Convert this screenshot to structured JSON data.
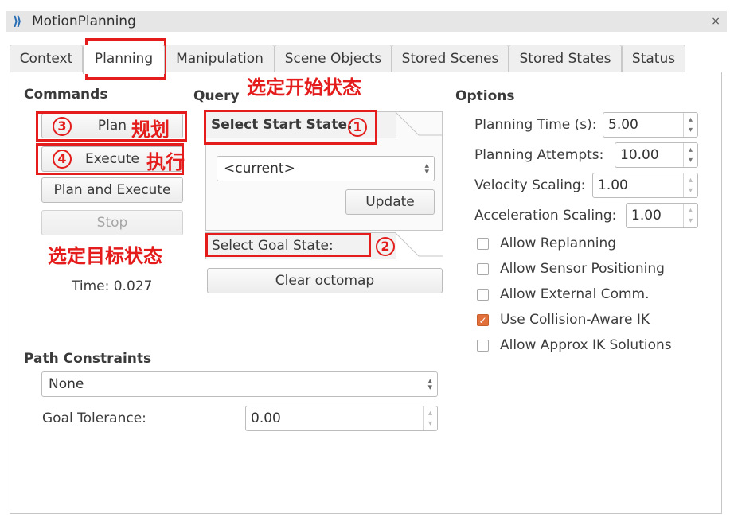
{
  "window": {
    "title": "MotionPlanning",
    "close": "×"
  },
  "tabs": [
    "Context",
    "Planning",
    "Manipulation",
    "Scene Objects",
    "Stored Scenes",
    "Stored States",
    "Status"
  ],
  "commands": {
    "label": "Commands",
    "plan": "Plan",
    "execute": "Execute",
    "plan_and_execute": "Plan and Execute",
    "stop": "Stop",
    "time": "Time: 0.027"
  },
  "query": {
    "label": "Query",
    "start_state_label": "Select Start State:",
    "start_state_value": "<current>",
    "update": "Update",
    "goal_state_label": "Select Goal State:",
    "clear_octomap": "Clear octomap"
  },
  "options": {
    "label": "Options",
    "planning_time_label": "Planning Time (s):",
    "planning_time": "5.00",
    "planning_attempts_label": "Planning Attempts:",
    "planning_attempts": "10.00",
    "velocity_scaling_label": "Velocity Scaling:",
    "velocity_scaling": "1.00",
    "acceleration_scaling_label": "Acceleration Scaling:",
    "acceleration_scaling": "1.00",
    "checkboxes": [
      {
        "label": "Allow Replanning",
        "checked": false
      },
      {
        "label": "Allow Sensor Positioning",
        "checked": false
      },
      {
        "label": "Allow External Comm.",
        "checked": false
      },
      {
        "label": "Use Collision-Aware IK",
        "checked": true
      },
      {
        "label": "Allow Approx IK Solutions",
        "checked": false
      }
    ]
  },
  "path_constraints": {
    "label": "Path Constraints",
    "value": "None",
    "goal_tolerance_label": "Goal Tolerance:",
    "goal_tolerance": "0.00"
  },
  "annotations": {
    "start_state": "选定开始状态",
    "goal_state": "选定目标状态",
    "plan": "规划",
    "execute": "执行",
    "n1": "1",
    "n2": "2",
    "n3": "3",
    "n4": "4"
  },
  "colors": {
    "annotation_red": "#e41c1c",
    "checkbox_orange": "#e2703a"
  }
}
